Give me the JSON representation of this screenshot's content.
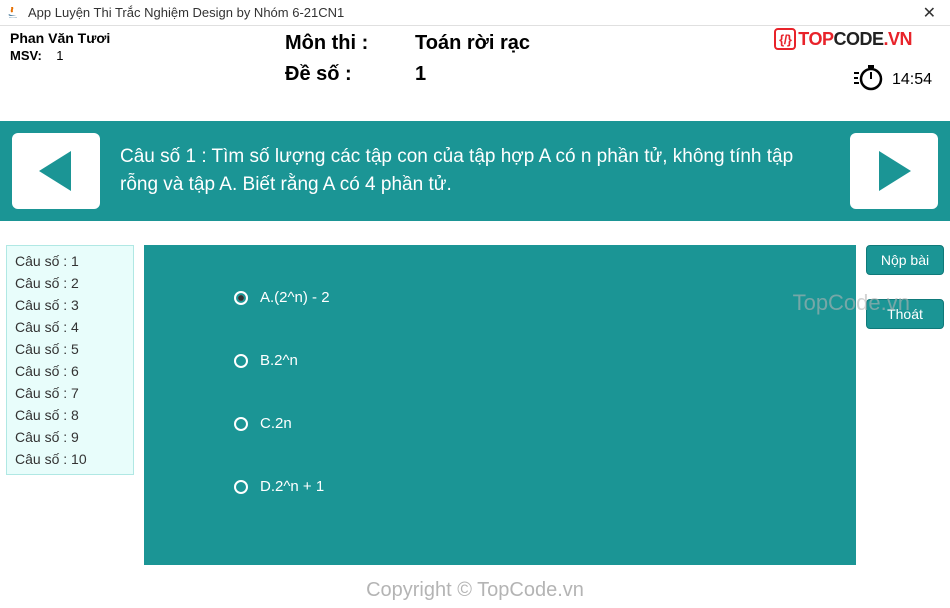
{
  "titlebar": {
    "title": "App Luyện Thi Trắc Nghiệm Design by Nhóm 6-21CN1"
  },
  "logo": {
    "part1": "TOP",
    "part2": "CODE",
    "part3": ".VN",
    "brace": "{/}"
  },
  "user": {
    "name": "Phan Văn Tươi",
    "msv_label": "MSV:",
    "msv_value": "1"
  },
  "exam": {
    "subject_label": "Môn thi :",
    "subject_value": "Toán rời rạc",
    "code_label": "Đề số :",
    "code_value": "1"
  },
  "timer": {
    "value": "14:54"
  },
  "question": {
    "text": "Câu số 1 : Tìm số lượng các tập con của tập hợp A có n phần tử, không tính tập rỗng và tập A. Biết rằng A có 4 phần tử."
  },
  "qlist": {
    "items": [
      "Câu số : 1",
      "Câu số : 2",
      "Câu số : 3",
      "Câu số : 4",
      "Câu số : 5",
      "Câu số : 6",
      "Câu số : 7",
      "Câu số : 8",
      "Câu số : 9",
      "Câu số : 10"
    ]
  },
  "answers": {
    "a": "A.(2^n) - 2",
    "b": "B.2^n",
    "c": "C.2n",
    "d": "D.2^n + 1",
    "selected": "a"
  },
  "actions": {
    "submit": "Nộp bài",
    "exit": "Thoát"
  },
  "watermark": {
    "w1": "TopCode.vn",
    "w2": "Copyright © TopCode.vn"
  }
}
